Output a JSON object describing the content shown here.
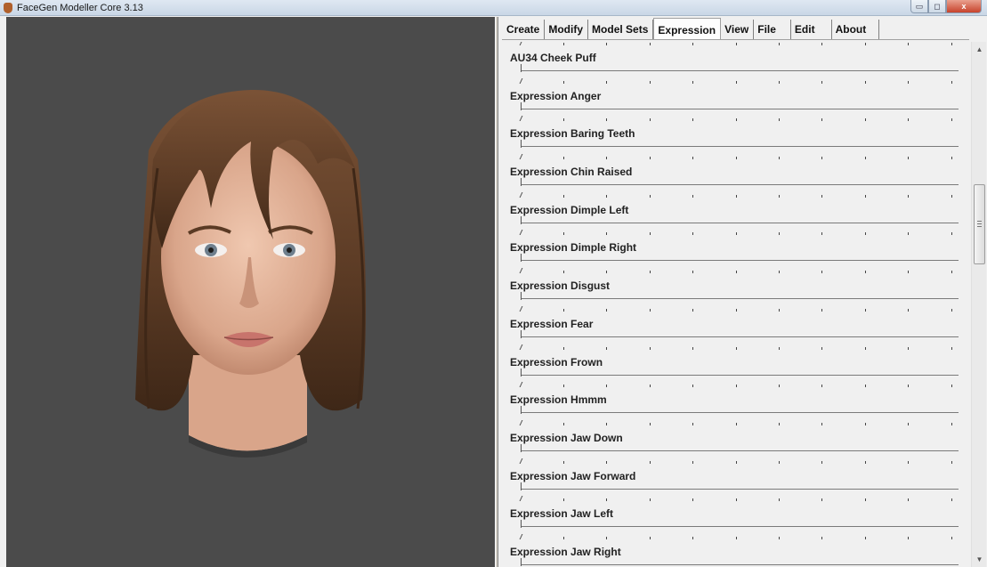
{
  "window": {
    "title": "FaceGen Modeller Core 3.13",
    "minimize_glyph": "▭",
    "maximize_glyph": "◻",
    "close_glyph": "x"
  },
  "tabs": [
    {
      "label": "Create",
      "active": false
    },
    {
      "label": "Modify",
      "active": false
    },
    {
      "label": "Model Sets",
      "active": false
    },
    {
      "label": "Expression",
      "active": true
    },
    {
      "label": "View",
      "active": false
    },
    {
      "label": "File",
      "active": false
    },
    {
      "label": "Edit",
      "active": false
    },
    {
      "label": "About",
      "active": false
    }
  ],
  "sliders": [
    {
      "label": "AU34 Cheek Puff",
      "value": 0
    },
    {
      "label": "Expression Anger",
      "value": 0
    },
    {
      "label": "Expression Baring Teeth",
      "value": 0
    },
    {
      "label": "Expression Chin Raised",
      "value": 0
    },
    {
      "label": "Expression Dimple Left",
      "value": 0
    },
    {
      "label": "Expression Dimple Right",
      "value": 0
    },
    {
      "label": "Expression Disgust",
      "value": 0
    },
    {
      "label": "Expression Fear",
      "value": 0
    },
    {
      "label": "Expression Frown",
      "value": 0
    },
    {
      "label": "Expression Hmmm",
      "value": 0
    },
    {
      "label": "Expression Jaw Down",
      "value": 0
    },
    {
      "label": "Expression Jaw Forward",
      "value": 0
    },
    {
      "label": "Expression Jaw Left",
      "value": 0
    },
    {
      "label": "Expression Jaw Right",
      "value": 0
    }
  ],
  "scrollbar": {
    "up_glyph": "▲",
    "down_glyph": "▼",
    "position": 0.35
  },
  "colors": {
    "viewport_bg": "#4b4b4b",
    "panel_bg": "#f0f0f0",
    "hair": "#5a3a24",
    "skin": "#e3b49c"
  }
}
